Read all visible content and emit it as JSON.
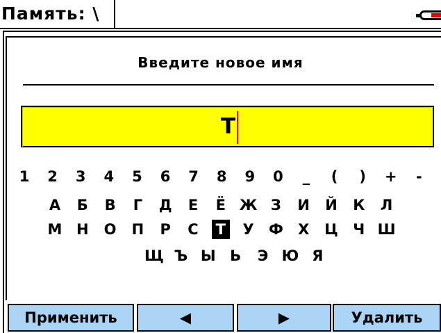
{
  "header": {
    "title": "Память: \\",
    "battery_icon": "battery-low-icon",
    "battery_level": 0.3,
    "battery_color": "#e00000"
  },
  "prompt": "Введите новое имя",
  "name_field": {
    "value": "Т",
    "background": "#ffff00",
    "caret_color": "#e00000"
  },
  "keyboard": {
    "rows": [
      [
        "1",
        "2",
        "3",
        "4",
        "5",
        "6",
        "7",
        "8",
        "9",
        "0",
        "_",
        "(",
        ")",
        "+",
        "-"
      ],
      [
        "А",
        "Б",
        "В",
        "Г",
        "Д",
        "Е",
        "Ё",
        "Ж",
        "З",
        "И",
        "Й",
        "К",
        "Л"
      ],
      [
        "М",
        "Н",
        "О",
        "П",
        "Р",
        "С",
        "Т",
        "У",
        "Ф",
        "Х",
        "Ц",
        "Ч",
        "Ш"
      ],
      [
        "Щ",
        "Ъ",
        "Ы",
        "Ь",
        "Э",
        "Ю",
        "Я"
      ]
    ],
    "selected_key": "Т"
  },
  "softkeys": {
    "apply": "Применить",
    "left": "◀",
    "right": "▶",
    "delete": "Удалить",
    "color": "#a9d4f5"
  }
}
